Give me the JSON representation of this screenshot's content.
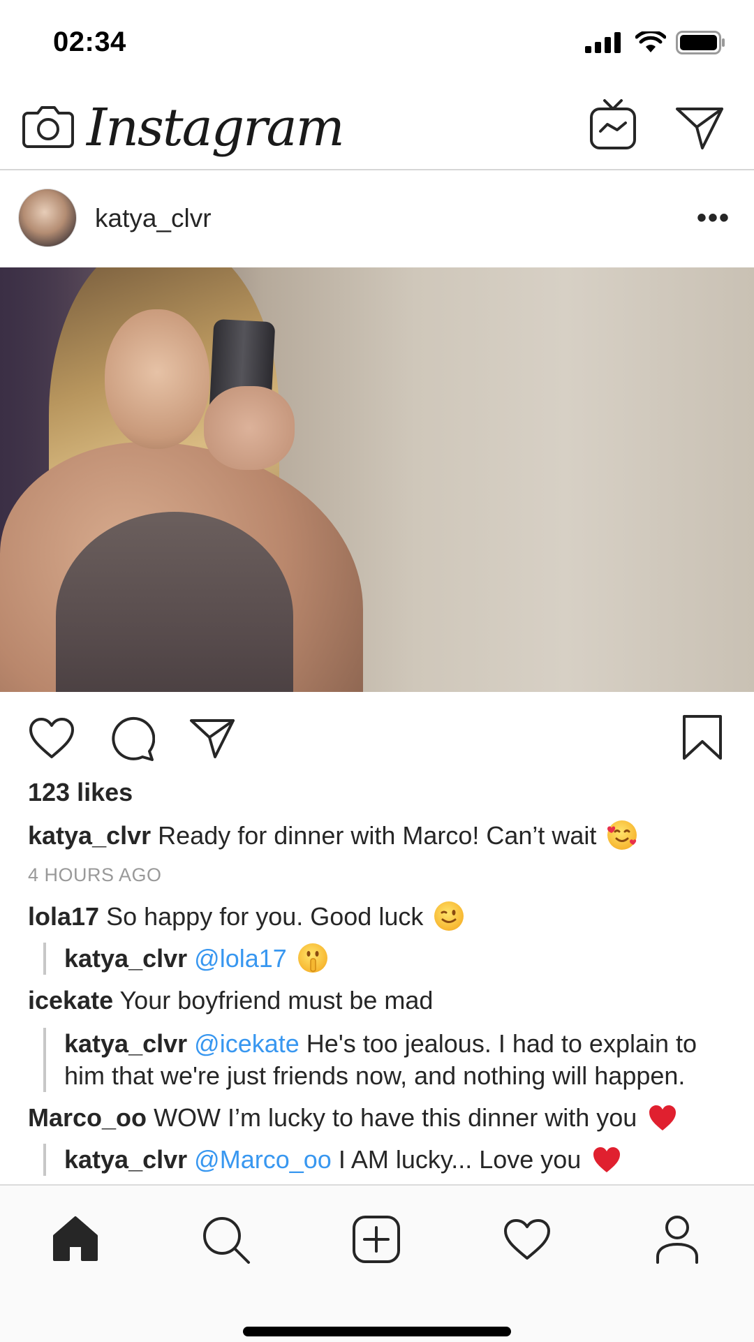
{
  "status_bar": {
    "time": "02:34"
  },
  "app": {
    "title": "Instagram"
  },
  "post": {
    "username": "katya_clvr",
    "likes": "123 likes",
    "caption": {
      "username": "katya_clvr",
      "text": "Ready for dinner with Marco! Can’t wait"
    },
    "time_ago": "4 HOURS AGO"
  },
  "comments": [
    {
      "username": "lola17",
      "text": "So happy for you. Good luck"
    },
    {
      "username": "katya_clvr",
      "mention": "@lola17",
      "text": ""
    },
    {
      "username": "icekate",
      "text": "Your boyfriend must be mad"
    },
    {
      "username": "katya_clvr",
      "mention": "@icekate",
      "text_line1": "He's too jealous. I had to explain to",
      "text_line2": "him that we're just friends now, and nothing will happen."
    },
    {
      "username": "Marco_oo",
      "text": "WOW I’m lucky to have this dinner with you"
    },
    {
      "username": "katya_clvr",
      "mention": "@Marco_oo",
      "text": "I AM lucky... Love you"
    }
  ],
  "icons": {
    "camera": "camera-icon",
    "igtv": "igtv-icon",
    "direct": "direct-message-icon",
    "more": "more-options-icon",
    "like": "heart-icon",
    "comment": "comment-icon",
    "share": "share-icon",
    "save": "bookmark-icon",
    "nav_home": "home-icon",
    "nav_search": "search-icon",
    "nav_add": "add-post-icon",
    "nav_activity": "activity-heart-icon",
    "nav_profile": "profile-icon"
  },
  "colors": {
    "mention": "#3897f0",
    "text": "#262626",
    "muted": "#999999",
    "divider": "#d6d6d6",
    "nav_bg": "#fafafa"
  }
}
